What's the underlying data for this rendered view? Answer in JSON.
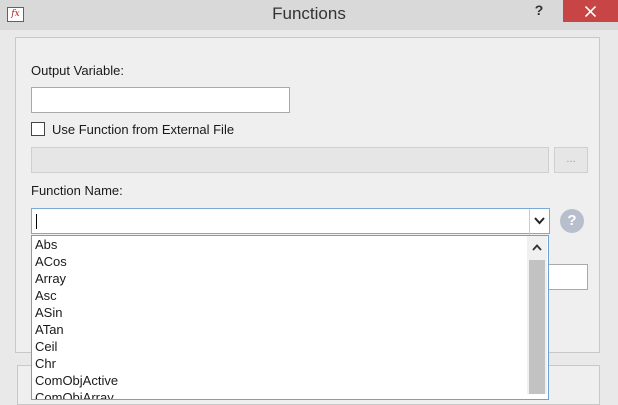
{
  "window": {
    "title": "Functions",
    "app_icon_text": "fx",
    "help_label": "?",
    "close_icon": "close-icon"
  },
  "form": {
    "output_variable": {
      "label": "Output Variable:",
      "value": ""
    },
    "external_file": {
      "label": "Use Function from External File",
      "checked": false,
      "path_value": "",
      "browse_label": "..."
    },
    "function_name": {
      "label": "Function Name:",
      "value": "",
      "help_icon": "help-circle-icon",
      "help_symbol": "?"
    }
  },
  "dropdown": {
    "items": [
      "Abs",
      "ACos",
      "Array",
      "Asc",
      "ASin",
      "ATan",
      "Ceil",
      "Chr",
      "ComObjActive",
      "ComObjArray"
    ]
  },
  "colors": {
    "close_button": "#c84545",
    "focus_border": "#7ea8d6"
  }
}
